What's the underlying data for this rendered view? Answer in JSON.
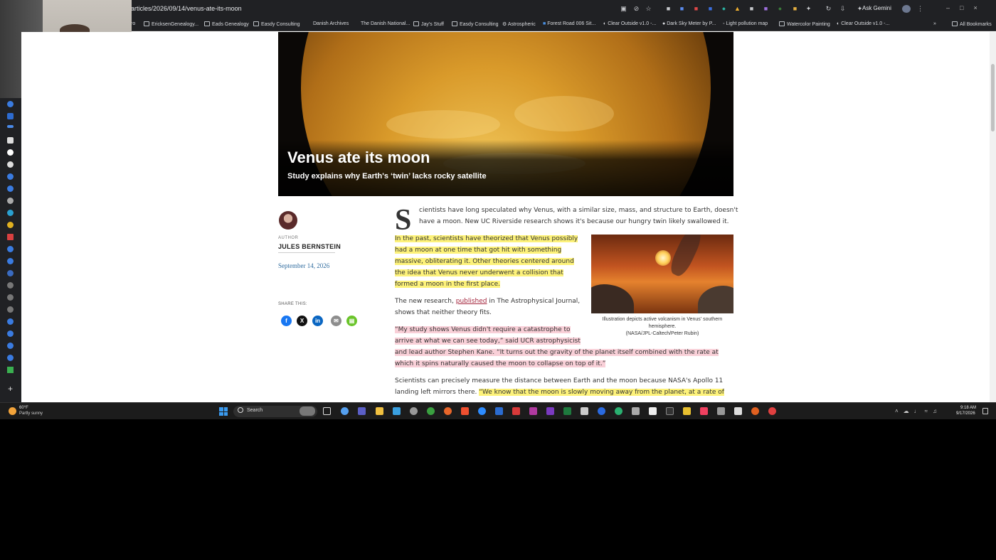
{
  "browser": {
    "url": "articles/2026/09/14/venus-ate-its-moon",
    "ask_gemini": "Ask Gemini",
    "bookmarks": [
      {
        "label": "ro"
      },
      {
        "label": "EricksenGenealogy..."
      },
      {
        "label": "Eads Genealogy"
      },
      {
        "label": "Easdy Consulting"
      },
      {
        "label": "Danish Archives"
      },
      {
        "label": "The Danish National..."
      },
      {
        "label": "Jay's Stuff"
      },
      {
        "label": "Easdy Consulting"
      },
      {
        "label": "Astrospheric"
      },
      {
        "label": "Forest Road 006 Sit..."
      },
      {
        "label": "Clear Outside v1.0 -..."
      },
      {
        "label": "Dark Sky Meter by P..."
      },
      {
        "label": "Light pollution map"
      },
      {
        "label": "Watercolor Painting"
      },
      {
        "label": "Clear Outside v1.0 -..."
      },
      {
        "label": "All Bookmarks"
      }
    ]
  },
  "article": {
    "title": "Venus ate its moon",
    "subtitle": "Study explains why Earth's ‘twin’ lacks rocky satellite",
    "author_label": "AUTHOR",
    "author_name": "JULES BERNSTEIN",
    "date": "September 14, 2026",
    "share_label": "SHARE THIS:",
    "share_buttons": [
      "facebook",
      "x",
      "linkedin",
      "email",
      "print"
    ],
    "dropcap": "S",
    "p1_line1": "cientists have long speculated why Venus, with a similar size, mass, and structure to Earth, doesn't",
    "p1_line2": "have a moon. New UC Riverside research shows it's because our hungry twin likely swallowed it.",
    "p2_lines": [
      "In the past, scientists have theorized that Venus possibly",
      "had a moon at one time that got hit with something",
      "massive, obliterating it. Other theories centered around",
      "the idea that Venus never underwent a collision that",
      "formed a moon in the first place."
    ],
    "p3_pre": "The new research, ",
    "p3_link": "published",
    "p3_post": " in The Astrophysical Journal,",
    "p3_line2": "shows that neither theory fits.",
    "p4_lines": [
      "“My study shows Venus didn't require a catastrophe to",
      "arrive at what we can see today,” said UCR astrophysicist",
      "and lead author Stephen Kane. “It turns out the gravity of the planet itself combined with the rate at",
      "which it spins naturally caused the moon to collapse on top of it.”"
    ],
    "p5_line1": "Scientists can precisely measure the distance between Earth and the moon because NASA's Apollo 11",
    "p5_line2_plain": "landing left mirrors there. ",
    "p5_line2_hl": "“We know that the moon is slowly moving away from the planet, at a rate of",
    "figure_caption_1": "Illustration depicts active volcanism in Venus' southern hemisphere.",
    "figure_caption_2": "(NASA/JPL-Caltech/Peter Rubin)"
  },
  "taskbar": {
    "weather_temp": "60°F",
    "weather_desc": "Partly sunny",
    "search_placeholder": "Search",
    "time": "9:18 AM",
    "date": "9/17/2026"
  }
}
